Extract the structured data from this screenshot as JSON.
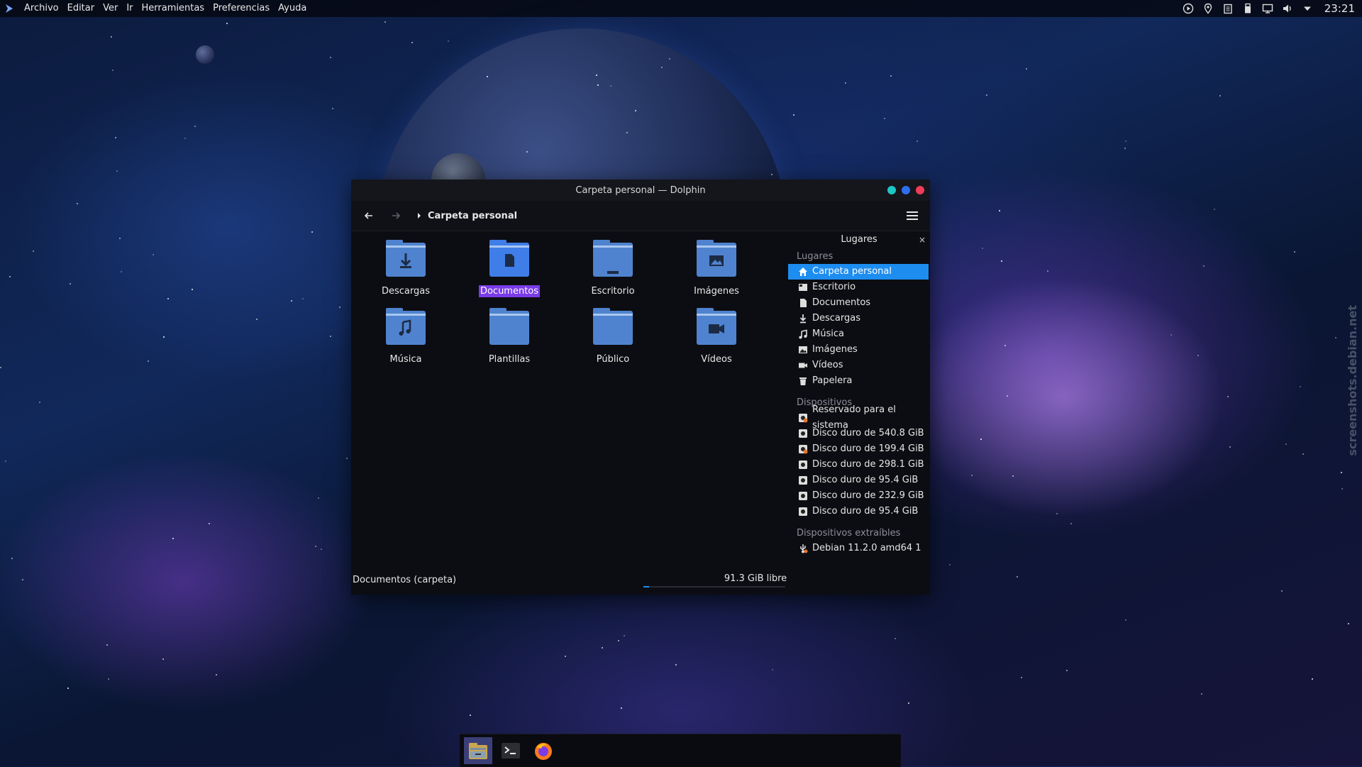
{
  "topbar": {
    "menu": [
      "Archivo",
      "Editar",
      "Ver",
      "Ir",
      "Herramientas",
      "Preferencias",
      "Ayuda"
    ],
    "tray_icons": [
      "media-play-icon",
      "location-icon",
      "clipboard-icon",
      "usb-icon",
      "display-icon",
      "volume-icon",
      "dropdown-icon"
    ],
    "clock": "23:21"
  },
  "window": {
    "title": "Carpeta personal — Dolphin",
    "button_colors": [
      "#1fc6c6",
      "#2d6ef0",
      "#f03c5a"
    ],
    "breadcrumb": "Carpeta personal",
    "files": [
      {
        "name": "Descargas",
        "icon": "download-folder-icon",
        "selected": false
      },
      {
        "name": "Documentos",
        "icon": "documents-folder-icon",
        "selected": true
      },
      {
        "name": "Escritorio",
        "icon": "desktop-folder-icon",
        "selected": false
      },
      {
        "name": "Imágenes",
        "icon": "pictures-folder-icon",
        "selected": false
      },
      {
        "name": "Música",
        "icon": "music-folder-icon",
        "selected": false
      },
      {
        "name": "Plantillas",
        "icon": "templates-folder-icon",
        "selected": false
      },
      {
        "name": "Público",
        "icon": "public-folder-icon",
        "selected": false
      },
      {
        "name": "Vídeos",
        "icon": "videos-folder-icon",
        "selected": false
      }
    ],
    "places_panel": {
      "title": "Lugares",
      "close": "×",
      "sections": [
        {
          "title": "Lugares",
          "items": [
            {
              "label": "Carpeta personal",
              "icon": "home-icon",
              "active": true
            },
            {
              "label": "Escritorio",
              "icon": "desktop-icon",
              "active": false
            },
            {
              "label": "Documentos",
              "icon": "document-icon",
              "active": false
            },
            {
              "label": "Descargas",
              "icon": "download-icon",
              "active": false
            },
            {
              "label": "Música",
              "icon": "music-icon",
              "active": false
            },
            {
              "label": "Imágenes",
              "icon": "image-icon",
              "active": false
            },
            {
              "label": "Vídeos",
              "icon": "video-icon",
              "active": false
            },
            {
              "label": "Papelera",
              "icon": "trash-icon",
              "active": false
            }
          ]
        },
        {
          "title": "Dispositivos",
          "items": [
            {
              "label": "Reservado para el sistema",
              "icon": "drive-warning-icon"
            },
            {
              "label": "Disco duro de 540.8 GiB",
              "icon": "hard-drive-icon"
            },
            {
              "label": "Disco duro de 199.4 GiB",
              "icon": "drive-warning-icon"
            },
            {
              "label": "Disco duro de 298.1 GiB",
              "icon": "hard-drive-icon"
            },
            {
              "label": "Disco duro de 95.4 GiB",
              "icon": "hard-drive-icon"
            },
            {
              "label": "Disco duro de 232.9 GiB",
              "icon": "hard-drive-icon"
            },
            {
              "label": "Disco duro de 95.4 GiB",
              "icon": "hard-drive-icon"
            }
          ]
        },
        {
          "title": "Dispositivos extraíbles",
          "items": [
            {
              "label": "Debian 11.2.0 amd64 1",
              "icon": "removable-media-icon"
            }
          ]
        }
      ]
    },
    "status": {
      "selection": "Documentos (carpeta)",
      "free_space": "91.3 GiB libre",
      "used_fraction": 0.04
    }
  },
  "taskbar": {
    "apps": [
      {
        "name": "Dolphin",
        "icon": "file-manager-icon",
        "active": true
      },
      {
        "name": "Terminal",
        "icon": "terminal-icon",
        "active": false
      },
      {
        "name": "Firefox",
        "icon": "firefox-icon",
        "active": false
      }
    ]
  },
  "watermark": "screenshots.debian.net"
}
